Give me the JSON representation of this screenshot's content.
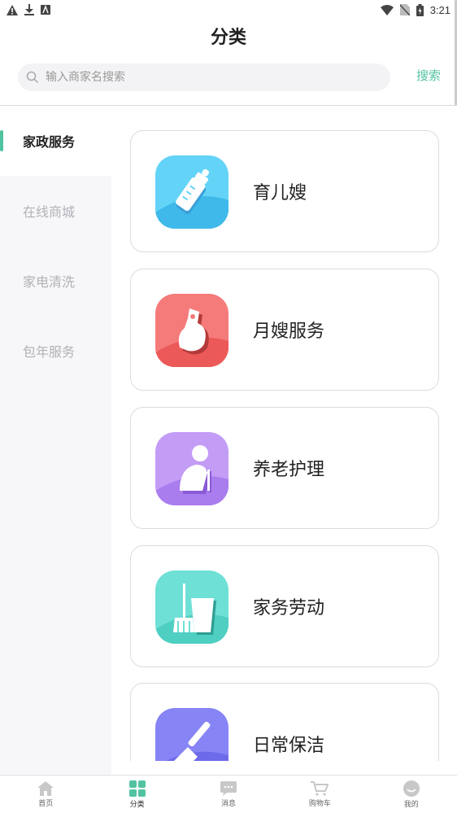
{
  "status_bar": {
    "time": "3:21"
  },
  "header": {
    "title": "分类"
  },
  "search": {
    "placeholder": "输入商家名搜索",
    "button_label": "搜索"
  },
  "sidebar": {
    "items": [
      {
        "label": "家政服务",
        "active": true
      },
      {
        "label": "在线商城",
        "active": false
      },
      {
        "label": "家电清洗",
        "active": false
      },
      {
        "label": "包年服务",
        "active": false
      }
    ]
  },
  "categories": [
    {
      "label": "育儿嫂",
      "icon": "baby-bottle-icon",
      "color": "#56c8f0"
    },
    {
      "label": "月嫂服务",
      "icon": "pregnant-icon",
      "color": "#f06a6a"
    },
    {
      "label": "养老护理",
      "icon": "elderly-icon",
      "color": "#b48cf0"
    },
    {
      "label": "家务劳动",
      "icon": "broom-bucket-icon",
      "color": "#5dd8c8"
    },
    {
      "label": "日常保洁",
      "icon": "brush-icon",
      "color": "#7a78f0"
    }
  ],
  "tabbar": {
    "items": [
      {
        "label": "首页",
        "icon": "home-icon"
      },
      {
        "label": "分类",
        "icon": "grid-icon",
        "active": true
      },
      {
        "label": "消息",
        "icon": "message-icon"
      },
      {
        "label": "购物车",
        "icon": "cart-icon"
      },
      {
        "label": "我的",
        "icon": "profile-icon"
      }
    ]
  },
  "colors": {
    "accent": "#52c3a1"
  }
}
